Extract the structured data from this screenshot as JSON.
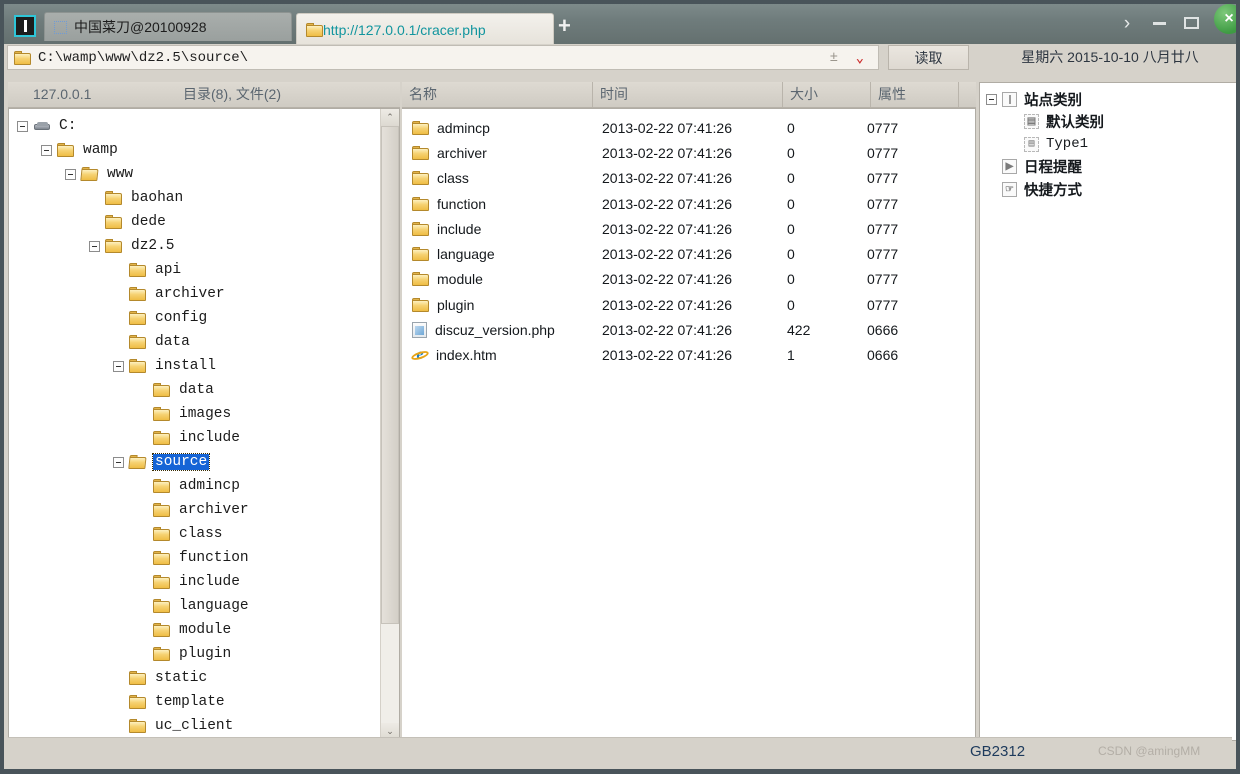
{
  "window": {
    "app_icon": "chopper-icon",
    "tabs": [
      {
        "label": "中国菜刀@20100928",
        "icon": "placeholder-icon",
        "active": false
      },
      {
        "label": "http://127.0.0.1/cracer.php",
        "icon": "folder-icon",
        "active": true
      }
    ],
    "new_tab_label": "+",
    "controls": {
      "expand_label": "›",
      "minimize_label": "−",
      "maximize_label": "□",
      "close_label": "×",
      "close_color": "#3e9b43"
    }
  },
  "addressbar": {
    "icon": "folder-icon",
    "path": "C:\\wamp\\www\\dz2.5\\source\\",
    "spinner_label": "±",
    "dropdown_label": "⌄",
    "read_button_label": "读取",
    "date_label": "星期六 2015-10-10 八月廿八"
  },
  "tree_header": {
    "host": "127.0.0.1",
    "counts": "目录(8), 文件(2)"
  },
  "list_header": {
    "name": "名称",
    "time": "时间",
    "size": "大小",
    "attr": "属性"
  },
  "tree": [
    {
      "label": "C:",
      "indent": 0,
      "expander": "minus",
      "icon": "drive-icon",
      "selected": false
    },
    {
      "label": "wamp",
      "indent": 1,
      "expander": "minus",
      "icon": "folder-icon",
      "selected": false
    },
    {
      "label": "www",
      "indent": 2,
      "expander": "minus",
      "icon": "folder-open-icon",
      "selected": false
    },
    {
      "label": "baohan",
      "indent": 3,
      "expander": "none",
      "icon": "folder-icon",
      "selected": false
    },
    {
      "label": "dede",
      "indent": 3,
      "expander": "none",
      "icon": "folder-icon",
      "selected": false
    },
    {
      "label": "dz2.5",
      "indent": 3,
      "expander": "minus",
      "icon": "folder-icon",
      "selected": false
    },
    {
      "label": "api",
      "indent": 4,
      "expander": "none",
      "icon": "folder-icon",
      "selected": false
    },
    {
      "label": "archiver",
      "indent": 4,
      "expander": "none",
      "icon": "folder-icon",
      "selected": false
    },
    {
      "label": "config",
      "indent": 4,
      "expander": "none",
      "icon": "folder-icon",
      "selected": false
    },
    {
      "label": "data",
      "indent": 4,
      "expander": "none",
      "icon": "folder-icon",
      "selected": false
    },
    {
      "label": "install",
      "indent": 4,
      "expander": "minus",
      "icon": "folder-icon",
      "selected": false
    },
    {
      "label": "data",
      "indent": 5,
      "expander": "none",
      "icon": "folder-icon",
      "selected": false
    },
    {
      "label": "images",
      "indent": 5,
      "expander": "none",
      "icon": "folder-icon",
      "selected": false
    },
    {
      "label": "include",
      "indent": 5,
      "expander": "none",
      "icon": "folder-icon",
      "selected": false
    },
    {
      "label": "source",
      "indent": 4,
      "expander": "minus",
      "icon": "folder-open-icon",
      "selected": true
    },
    {
      "label": "admincp",
      "indent": 5,
      "expander": "none",
      "icon": "folder-icon",
      "selected": false
    },
    {
      "label": "archiver",
      "indent": 5,
      "expander": "none",
      "icon": "folder-icon",
      "selected": false
    },
    {
      "label": "class",
      "indent": 5,
      "expander": "none",
      "icon": "folder-icon",
      "selected": false
    },
    {
      "label": "function",
      "indent": 5,
      "expander": "none",
      "icon": "folder-icon",
      "selected": false
    },
    {
      "label": "include",
      "indent": 5,
      "expander": "none",
      "icon": "folder-icon",
      "selected": false
    },
    {
      "label": "language",
      "indent": 5,
      "expander": "none",
      "icon": "folder-icon",
      "selected": false
    },
    {
      "label": "module",
      "indent": 5,
      "expander": "none",
      "icon": "folder-icon",
      "selected": false
    },
    {
      "label": "plugin",
      "indent": 5,
      "expander": "none",
      "icon": "folder-icon",
      "selected": false
    },
    {
      "label": "static",
      "indent": 4,
      "expander": "none",
      "icon": "folder-icon",
      "selected": false
    },
    {
      "label": "template",
      "indent": 4,
      "expander": "none",
      "icon": "folder-icon",
      "selected": false
    },
    {
      "label": "uc_client",
      "indent": 4,
      "expander": "none",
      "icon": "folder-icon",
      "selected": false
    },
    {
      "label": "",
      "indent": 4,
      "expander": "none",
      "icon": "folder-icon",
      "selected": false
    }
  ],
  "files": [
    {
      "name": "admincp",
      "icon": "folder-icon",
      "time": "2013-02-22 07:41:26",
      "size": "0",
      "attr": "0777"
    },
    {
      "name": "archiver",
      "icon": "folder-icon",
      "time": "2013-02-22 07:41:26",
      "size": "0",
      "attr": "0777"
    },
    {
      "name": "class",
      "icon": "folder-icon",
      "time": "2013-02-22 07:41:26",
      "size": "0",
      "attr": "0777"
    },
    {
      "name": "function",
      "icon": "folder-icon",
      "time": "2013-02-22 07:41:26",
      "size": "0",
      "attr": "0777"
    },
    {
      "name": "include",
      "icon": "folder-icon",
      "time": "2013-02-22 07:41:26",
      "size": "0",
      "attr": "0777"
    },
    {
      "name": "language",
      "icon": "folder-icon",
      "time": "2013-02-22 07:41:26",
      "size": "0",
      "attr": "0777"
    },
    {
      "name": "module",
      "icon": "folder-icon",
      "time": "2013-02-22 07:41:26",
      "size": "0",
      "attr": "0777"
    },
    {
      "name": "plugin",
      "icon": "folder-icon",
      "time": "2013-02-22 07:41:26",
      "size": "0",
      "attr": "0777"
    },
    {
      "name": "discuz_version.php",
      "icon": "php-file-icon",
      "time": "2013-02-22 07:41:26",
      "size": "422",
      "attr": "0666"
    },
    {
      "name": "index.htm",
      "icon": "ie-html-icon",
      "time": "2013-02-22 07:41:26",
      "size": "1",
      "attr": "0666"
    }
  ],
  "side_tree": [
    {
      "label": "站点类别",
      "indent": 0,
      "expander": "minus",
      "icon": "window-icon",
      "mono": false
    },
    {
      "label": "默认类别",
      "indent": 1,
      "expander": "none",
      "icon": "category-icon",
      "mono": false
    },
    {
      "label": "Type1",
      "indent": 1,
      "expander": "none",
      "icon": "category-icon",
      "mono": true
    },
    {
      "label": "日程提醒",
      "indent": 0,
      "expander": "none",
      "icon": "schedule-icon",
      "mono": false
    },
    {
      "label": "快捷方式",
      "indent": 0,
      "expander": "none",
      "icon": "shortcut-icon",
      "mono": false
    }
  ],
  "statusbar": {
    "encoding": "GB2312",
    "watermark": "CSDN @amingMM"
  }
}
